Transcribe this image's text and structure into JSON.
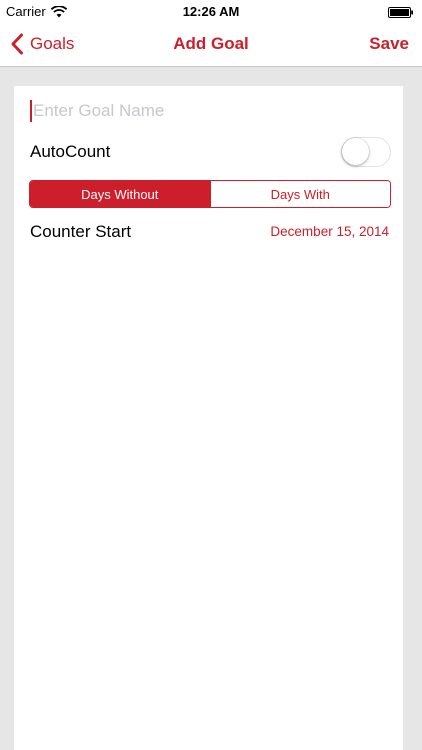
{
  "status_bar": {
    "carrier": "Carrier",
    "time": "12:26 AM"
  },
  "nav": {
    "back_label": "Goals",
    "title": "Add Goal",
    "save_label": "Save"
  },
  "form": {
    "goal_name_placeholder": "Enter Goal Name",
    "goal_name_value": "",
    "autocount_label": "AutoCount",
    "autocount_on": false,
    "segments": [
      {
        "label": "Days Without",
        "selected": true
      },
      {
        "label": "Days With",
        "selected": false
      }
    ],
    "counter_start_label": "Counter Start",
    "counter_start_value": "December 15, 2014"
  },
  "colors": {
    "accent": "#cc1f2b",
    "background": "#e6e6e6",
    "card": "#ffffff",
    "placeholder": "#c7c7cd"
  },
  "icons": {
    "wifi": "wifi-icon",
    "battery": "battery-icon",
    "back": "chevron-left-icon"
  }
}
